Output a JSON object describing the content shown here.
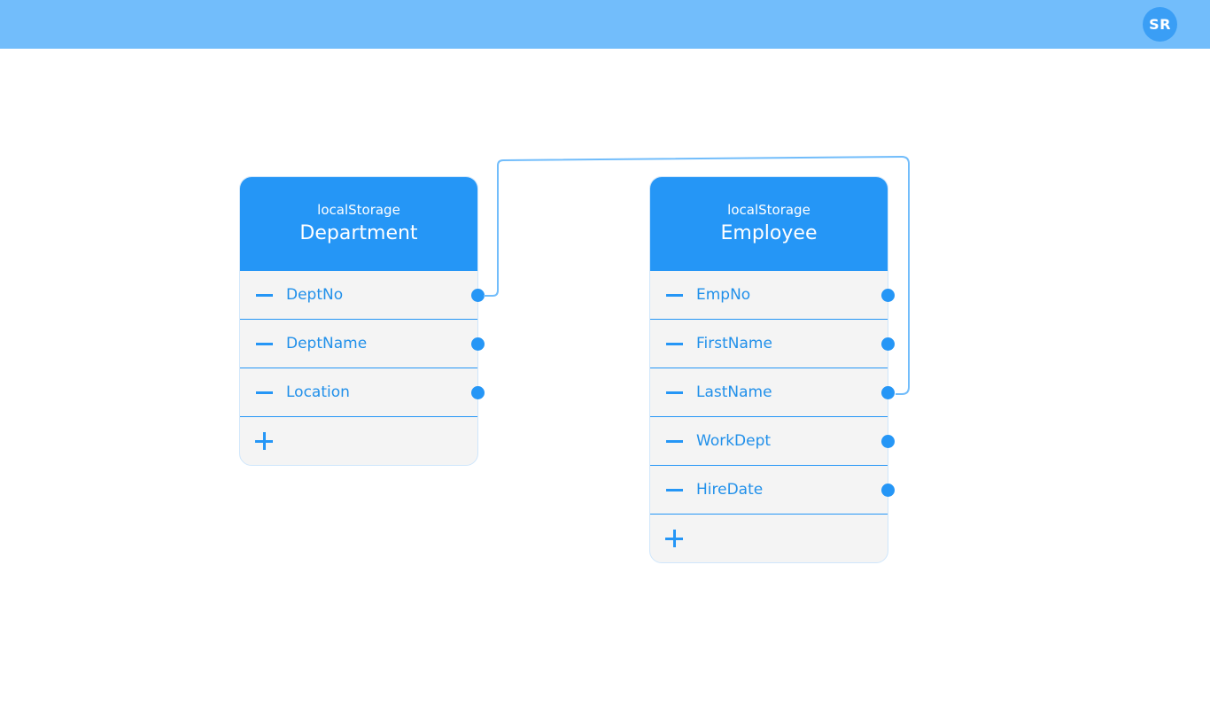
{
  "header": {
    "avatar_initials": "SR",
    "bar_color": "#72bdfb"
  },
  "colors": {
    "accent": "#2596f6",
    "connector": "#72bdfb",
    "row_background": "#f4f4f4",
    "field_text": "#2190ea"
  },
  "tables": {
    "department": {
      "storage": "localStorage",
      "title": "Department",
      "fields": [
        "DeptNo",
        "DeptName",
        "Location"
      ]
    },
    "employee": {
      "storage": "localStorage",
      "title": "Employee",
      "fields": [
        "EmpNo",
        "FirstName",
        "LastName",
        "WorkDept",
        "HireDate"
      ]
    }
  },
  "relations": [
    {
      "from": "Department.DeptNo",
      "to": "Employee.LastName"
    }
  ]
}
